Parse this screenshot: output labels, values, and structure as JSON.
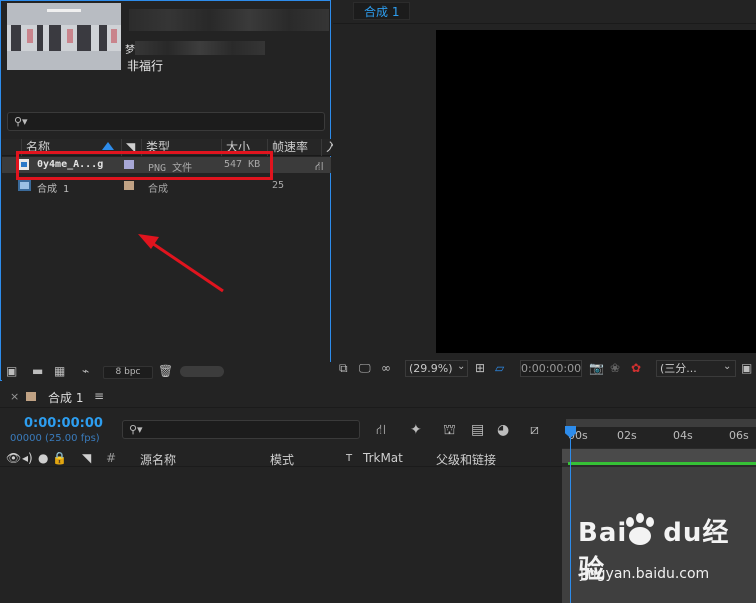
{
  "project": {
    "info_mark": "梦",
    "info_text": "非福行",
    "search_icon": "search-icon",
    "columns": {
      "name": "名称",
      "type": "类型",
      "size": "大小",
      "fps": "帧速率",
      "more": "入"
    },
    "items": [
      {
        "name": "0y4me_A...g",
        "type": "PNG 文件",
        "size": "547 KB",
        "fps": "",
        "icon": "image-file-icon",
        "swatch": "#a7a7d6"
      },
      {
        "name": "合成 1",
        "type": "合成",
        "size": "",
        "fps": "25",
        "icon": "composition-icon",
        "swatch": "#c0a284"
      }
    ],
    "bpc": "8 bpc"
  },
  "viewer": {
    "tab": "合成 1",
    "zoom": "(29.9%)",
    "timecode": "0:00:00:00",
    "resolution": "(三分..."
  },
  "timeline": {
    "close": "×",
    "comp_name": "合成 1",
    "menu": "≡",
    "timecode": "0:00:00:00",
    "timecode_sub": "00000 (25.00 fps)",
    "columns": {
      "source": "源名称",
      "mode": "模式",
      "t": "T",
      "trkmat": "TrkMat",
      "parent": "父级和链接",
      "hash": "#"
    },
    "ruler_ticks": [
      "00s",
      "02s",
      "04s",
      "06s"
    ]
  },
  "watermark": {
    "brand": "Bai",
    "brand2": "du",
    "cn": "经验",
    "url": "jingyan.baidu.com"
  },
  "colors": {
    "accent": "#2d8ceb",
    "annotation": "#e0141e",
    "timecode": "#2d9ef0"
  }
}
